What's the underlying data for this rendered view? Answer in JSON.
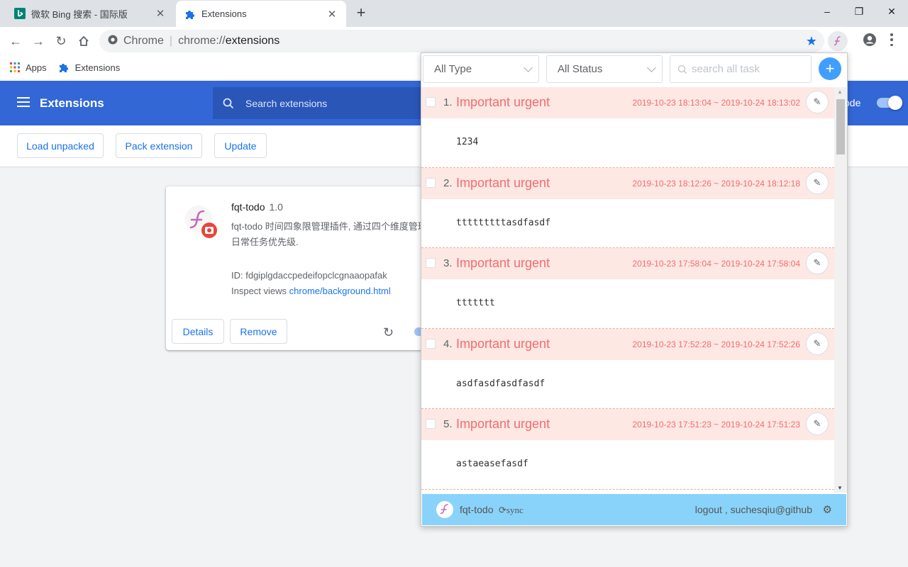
{
  "browser": {
    "tabs": [
      {
        "title": "微软 Bing 搜索 - 国际版",
        "close": "✕"
      },
      {
        "title": "Extensions",
        "close": "✕"
      }
    ],
    "new_tab": "+",
    "window_controls": {
      "minimize": "–",
      "restore": "❐",
      "close": "✕"
    },
    "url": {
      "site": "Chrome",
      "scheme": "chrome://",
      "host": "extensions"
    },
    "bookmarks": [
      {
        "label": "Apps",
        "icon": "apps-grid-icon"
      },
      {
        "label": "Extensions",
        "icon": "puzzle-icon"
      }
    ],
    "colors": {
      "accent": "#1a73e8"
    }
  },
  "extensions_page": {
    "title": "Extensions",
    "search_placeholder": "Search extensions",
    "dev_mode_label": "ode",
    "actions": [
      "Load unpacked",
      "Pack extension",
      "Update"
    ],
    "card": {
      "name": "fqt-todo",
      "version": "1.0",
      "description": "fqt-todo 时间四象限管理插件, 通过四个维度管理日常任务优先级.",
      "id_label": "ID: fdgiplgdaccpedeifopclcgnaaopafak",
      "inspect_label": "Inspect views",
      "inspect_link": "chrome/background.html",
      "details_button": "Details",
      "remove_button": "Remove"
    },
    "colors": {
      "header": "#3367d6"
    }
  },
  "popup": {
    "type_filter": "All Type",
    "status_filter": "All Status",
    "search_placeholder": "search all task",
    "add_label": "+",
    "tasks": [
      {
        "num": "1.",
        "level": "Important urgent",
        "range": "2019-10-23 18:13:04 ~ 2019-10-24 18:13:02",
        "content": "1234"
      },
      {
        "num": "2.",
        "level": "Important urgent",
        "range": "2019-10-23 18:12:26 ~ 2019-10-24 18:12:18",
        "content": "tttttttttasdfasdf"
      },
      {
        "num": "3.",
        "level": "Important urgent",
        "range": "2019-10-23 17:58:04 ~ 2019-10-24 17:58:04",
        "content": "ttttttt"
      },
      {
        "num": "4.",
        "level": "Important urgent",
        "range": "2019-10-23 17:52:28 ~ 2019-10-24 17:52:26",
        "content": "asdfasdfasdfasdf"
      },
      {
        "num": "5.",
        "level": "Important urgent",
        "range": "2019-10-23 17:51:23 ~ 2019-10-24 17:51:23",
        "content": "astaeasefasdf"
      }
    ],
    "footer": {
      "app_name": "fqt-todo",
      "sync_label": "sync",
      "user_label": "logout , suchesqiu@github"
    },
    "colors": {
      "urgent": "#f56c6c",
      "urgent_bg": "#fde8e4",
      "footer": "#89d3fa",
      "primary": "#409eff"
    }
  }
}
